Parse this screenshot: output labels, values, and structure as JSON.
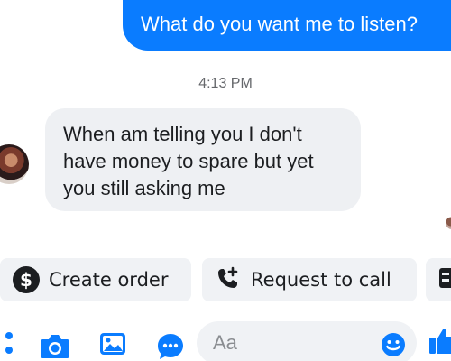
{
  "thread": {
    "outgoing_message": "What do you want me to listen?",
    "timestamp": "4:13 PM",
    "incoming_message": {
      "lines": [
        "When am telling you I don't",
        "have money to spare but yet",
        "you still asking me"
      ]
    }
  },
  "quick_actions": [
    {
      "label": "Create order",
      "icon": "dollar-circle-icon"
    },
    {
      "label": "Request to call",
      "icon": "phone-plus-icon"
    },
    {
      "label": "",
      "icon": "contact-card-icon"
    }
  ],
  "composer": {
    "placeholder": "Aa",
    "icons": [
      "more-options-icon",
      "camera-icon",
      "gallery-icon",
      "sticker-chat-icon",
      "emoji-icon",
      "thumbs-up-icon"
    ]
  },
  "colors": {
    "accent": "#0a7cff",
    "bubble_incoming": "#eef0f3",
    "chip_background": "#f0f2f5",
    "timestamp_text": "#65676b"
  }
}
